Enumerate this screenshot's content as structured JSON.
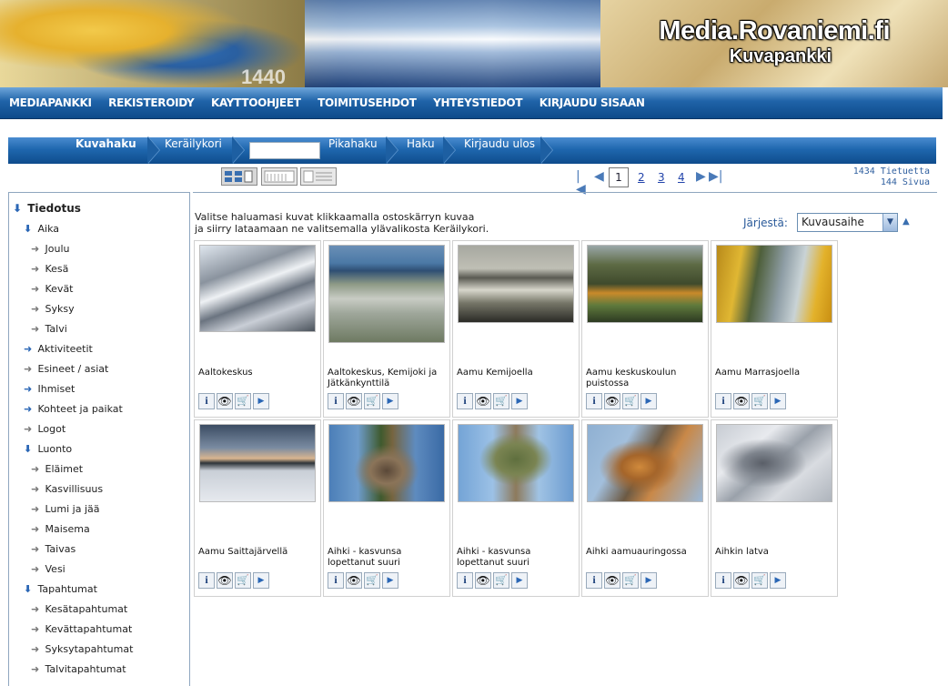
{
  "header": {
    "site_title": "Media.Rovaniemi.fi",
    "subtitle": "Kuvapankki",
    "banner_number": "1440"
  },
  "topnav": [
    "MEDIAPANKKI",
    "REKISTEROIDY",
    "KAYTTOOHJEET",
    "TOIMITUSEHDOT",
    "YHTEYSTIEDOT",
    "KIRJAUDU SISAAN"
  ],
  "subnav": {
    "items": [
      "Kuvahaku",
      "Keräilykori",
      "Pikahaku",
      "Haku",
      "Kirjaudu ulos"
    ],
    "search_value": ""
  },
  "pager": {
    "current": "1",
    "pages": [
      "2",
      "3",
      "4"
    ]
  },
  "counts": {
    "items": "1434 Tietuetta",
    "pages": "144 Sivua"
  },
  "sidebar": {
    "root": "Tiedotus",
    "items": [
      "Aika",
      "Joulu",
      "Kesä",
      "Kevät",
      "Syksy",
      "Talvi",
      "Aktiviteetit",
      "Esineet / asiat",
      "Ihmiset",
      "Kohteet ja paikat",
      "Logot",
      "Luonto",
      "Eläimet",
      "Kasvillisuus",
      "Lumi ja jää",
      "Maisema",
      "Taivas",
      "Vesi",
      "Tapahtumat",
      "Kesätapahtumat",
      "Kevättapahtumat",
      "Syksytapahtumat",
      "Talvitapahtumat"
    ]
  },
  "intro": {
    "line1": "Valitse haluamasi kuvat klikkaamalla ostoskärryn kuvaa",
    "line2": "ja siirry lataamaan ne valitsemalla ylävalikosta Keräilykori."
  },
  "sort": {
    "label": "Järjestä:",
    "value": "Kuvausaihe"
  },
  "images": [
    {
      "caption": "Aaltokeskus"
    },
    {
      "caption": "Aaltokeskus, Kemijoki ja Jätkänkynttilä"
    },
    {
      "caption": "Aamu Kemijoella"
    },
    {
      "caption": "Aamu keskuskoulun puistossa"
    },
    {
      "caption": "Aamu Marrasjoella"
    },
    {
      "caption": "Aamu Saittajärvellä"
    },
    {
      "caption": "Aihki - kasvunsa lopettanut suuri"
    },
    {
      "caption": "Aihki - kasvunsa lopettanut suuri"
    },
    {
      "caption": "Aihki aamuauringossa"
    },
    {
      "caption": "Aihkin latva"
    }
  ],
  "actions": {
    "info": "i",
    "view": "👁",
    "cart": "🛒",
    "more": "▶"
  }
}
